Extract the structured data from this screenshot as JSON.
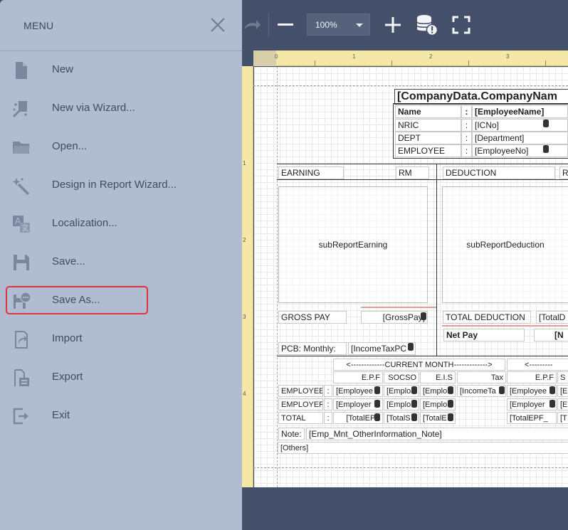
{
  "toolbar": {
    "zoom_value": "100%",
    "icons": [
      "redo-icon",
      "zoom-out-icon",
      "zoom-in-icon",
      "data-source-warning-icon",
      "fullscreen-icon"
    ]
  },
  "ruler": {
    "top_numbers": [
      "0",
      "1",
      "2",
      "3"
    ],
    "left_numbers": [
      "1",
      "2",
      "3",
      "4"
    ]
  },
  "menu": {
    "title": "MENU",
    "items": [
      {
        "label": "New",
        "icon": "new-file-icon"
      },
      {
        "label": "New via Wizard...",
        "icon": "wizard-icon"
      },
      {
        "label": "Open...",
        "icon": "folder-icon"
      },
      {
        "label": "Design in Report Wizard...",
        "icon": "magic-wand-icon"
      },
      {
        "label": "Localization...",
        "icon": "localization-icon"
      },
      {
        "label": "Save...",
        "icon": "save-icon"
      },
      {
        "label": "Save As...",
        "icon": "save-as-icon",
        "selected": true
      },
      {
        "label": "Import",
        "icon": "import-icon"
      },
      {
        "label": "Export",
        "icon": "export-icon"
      },
      {
        "label": "Exit",
        "icon": "exit-icon"
      }
    ]
  },
  "report": {
    "company": "[CompanyData.CompanyNam",
    "info": [
      {
        "label": "Name",
        "colon": ":",
        "value": "[EmployeeName]"
      },
      {
        "label": "NRIC",
        "colon": ":",
        "value": "[ICNo]"
      },
      {
        "label": "DEPT",
        "colon": ":",
        "value": "[Department]"
      },
      {
        "label": "EMPLOYEE",
        "colon": ":",
        "value": "[EmployeeNo]"
      }
    ],
    "earning": "EARNING",
    "rm_left": "RM",
    "deduction": "DEDUCTION",
    "rm_right": "R",
    "sub_earning": "subReportEarning",
    "sub_deduction": "subReportDeduction",
    "gross_pay": "GROSS PAY",
    "gross_pay_value": "[GrossPay]",
    "total_deduction": "TOTAL DEDUCTION",
    "total_deduction_value": "[TotalD",
    "net_pay": "Net Pay",
    "net_pay_value": "[N",
    "pcb_label": "PCB: Monthly:",
    "pcb_value": "[IncomeTaxPC",
    "current_month": "<-------------CURRENT MONTH------------->",
    "next_header": "<---------",
    "col_headers": [
      "E.P.F",
      "SOCSO",
      "E.I.S",
      "Tax",
      "E.P.F",
      "S"
    ],
    "rows": [
      {
        "label": "EMPLOYEE",
        "colon": ":",
        "cells": [
          "[Employee",
          "[Emplo",
          "[Emplo",
          "[IncomeTa",
          "[Employee",
          "[E"
        ]
      },
      {
        "label": "EMPLOYER",
        "colon": ":",
        "cells": [
          "[Employer",
          "[Emplo",
          "[Emplo",
          "",
          "[Employer",
          "[E"
        ]
      },
      {
        "label": "TOTAL",
        "colon": ":",
        "cells": [
          "[TotalEPF",
          "[TotalS",
          "[TotalE",
          "",
          "[TotalEPF_",
          "[T"
        ]
      }
    ],
    "note_label": "Note:",
    "note_value": "[Emp_Mnt_OtherInformation_Note]",
    "others": "[Others]"
  }
}
